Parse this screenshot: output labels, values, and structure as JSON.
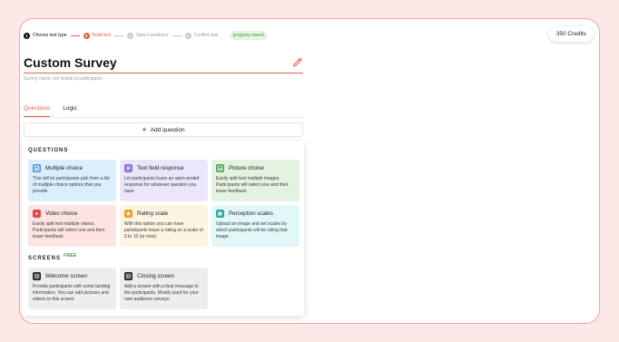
{
  "steps": [
    {
      "num": "1",
      "label": "Choose test type",
      "state": "done"
    },
    {
      "num": "2",
      "label": "Build test",
      "state": "active"
    },
    {
      "num": "3",
      "label": "Select audience",
      "state": "todo"
    },
    {
      "num": "4",
      "label": "Confirm test",
      "state": "todo"
    }
  ],
  "progress_saved": "progress saved",
  "credits": "350 Credits",
  "survey": {
    "title": "Custom Survey",
    "subtitle": "Survey name, not visible to participants"
  },
  "tabs": [
    "Questions",
    "Logic"
  ],
  "add_question": "Add question",
  "questions_header": "QUESTIONS",
  "screens_header": "SCREENS",
  "free_label": "FREE",
  "question_types": [
    {
      "name": "Multiple choice",
      "desc": "This will let participants pick from a list of multiple choice options that you provide",
      "icon": "checkbox-icon",
      "color": "#4a90d9"
    },
    {
      "name": "Text field response",
      "desc": "Let participants leave an open-ended response for whatever question you have",
      "icon": "text-lines-icon",
      "color": "#8b74d6"
    },
    {
      "name": "Picture choice",
      "desc": "Easily split test multiple images. Participants will select one and then leave feedback",
      "icon": "image-icon",
      "color": "#4fa35a"
    },
    {
      "name": "Video choice",
      "desc": "Easily split test multiple videos. Participants will select one and then leave feedback",
      "icon": "video-icon",
      "color": "#d94a4a"
    },
    {
      "name": "Rating scale",
      "desc": "With this option you can have participants leave a rating on a scale of 0 to 10 (or else)",
      "icon": "star-icon",
      "color": "#e6a32c"
    },
    {
      "name": "Perception scales",
      "desc": "Upload an image and set scales by which participants will be rating that image",
      "icon": "scales-icon",
      "color": "#2fa7a7"
    }
  ],
  "screen_types": [
    {
      "name": "Welcome screen",
      "desc": "Provide participants with some landing information. You can add pictures and videos to this screen",
      "icon": "welcome-screen-icon",
      "color": "#1a1a1a"
    },
    {
      "name": "Closing screen",
      "desc": "Add a screen with a final message to the participants. Mostly used for your own audience surveys",
      "icon": "closing-screen-icon",
      "color": "#1a1a1a"
    }
  ]
}
